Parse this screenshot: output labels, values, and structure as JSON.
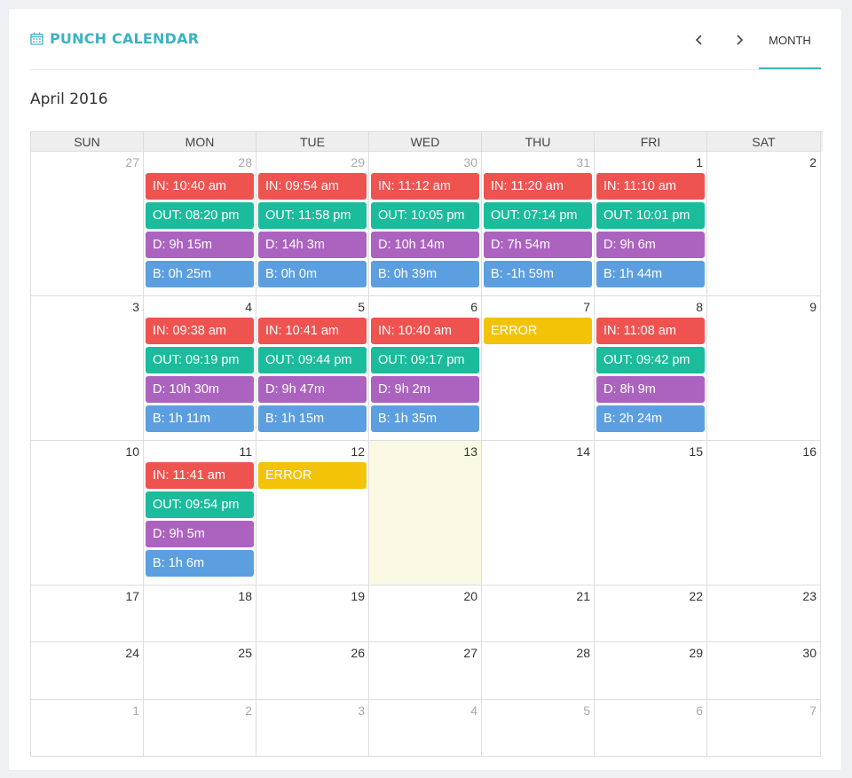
{
  "header": {
    "title": "PUNCH CALENDAR",
    "prev_label": "‹",
    "next_label": "›",
    "view_label": "MONTH"
  },
  "calendar": {
    "month_label": "April 2016",
    "weekdays": [
      "SUN",
      "MON",
      "TUE",
      "WED",
      "THU",
      "FRI",
      "SAT"
    ],
    "weeks": [
      [
        {
          "day": "27",
          "other": true,
          "events": []
        },
        {
          "day": "28",
          "other": true,
          "events": [
            {
              "type": "in",
              "text": "IN: 10:40 am"
            },
            {
              "type": "out",
              "text": "OUT: 08:20 pm"
            },
            {
              "type": "d",
              "text": "D: 9h 15m"
            },
            {
              "type": "b",
              "text": "B: 0h 25m"
            }
          ]
        },
        {
          "day": "29",
          "other": true,
          "events": [
            {
              "type": "in",
              "text": "IN: 09:54 am"
            },
            {
              "type": "out",
              "text": "OUT: 11:58 pm"
            },
            {
              "type": "d",
              "text": "D: 14h 3m"
            },
            {
              "type": "b",
              "text": "B: 0h 0m"
            }
          ]
        },
        {
          "day": "30",
          "other": true,
          "events": [
            {
              "type": "in",
              "text": "IN: 11:12 am"
            },
            {
              "type": "out",
              "text": "OUT: 10:05 pm"
            },
            {
              "type": "d",
              "text": "D: 10h 14m"
            },
            {
              "type": "b",
              "text": "B: 0h 39m"
            }
          ]
        },
        {
          "day": "31",
          "other": true,
          "events": [
            {
              "type": "in",
              "text": "IN: 11:20 am"
            },
            {
              "type": "out",
              "text": "OUT: 07:14 pm"
            },
            {
              "type": "d",
              "text": "D: 7h 54m"
            },
            {
              "type": "b",
              "text": "B: -1h 59m"
            }
          ]
        },
        {
          "day": "1",
          "other": false,
          "events": [
            {
              "type": "in",
              "text": "IN: 11:10 am"
            },
            {
              "type": "out",
              "text": "OUT: 10:01 pm"
            },
            {
              "type": "d",
              "text": "D: 9h 6m"
            },
            {
              "type": "b",
              "text": "B: 1h 44m"
            }
          ]
        },
        {
          "day": "2",
          "other": false,
          "events": []
        }
      ],
      [
        {
          "day": "3",
          "other": false,
          "events": []
        },
        {
          "day": "4",
          "other": false,
          "events": [
            {
              "type": "in",
              "text": "IN: 09:38 am"
            },
            {
              "type": "out",
              "text": "OUT: 09:19 pm"
            },
            {
              "type": "d",
              "text": "D: 10h 30m"
            },
            {
              "type": "b",
              "text": "B: 1h 11m"
            }
          ]
        },
        {
          "day": "5",
          "other": false,
          "events": [
            {
              "type": "in",
              "text": "IN: 10:41 am"
            },
            {
              "type": "out",
              "text": "OUT: 09:44 pm"
            },
            {
              "type": "d",
              "text": "D: 9h 47m"
            },
            {
              "type": "b",
              "text": "B: 1h 15m"
            }
          ]
        },
        {
          "day": "6",
          "other": false,
          "events": [
            {
              "type": "in",
              "text": "IN: 10:40 am"
            },
            {
              "type": "out",
              "text": "OUT: 09:17 pm"
            },
            {
              "type": "d",
              "text": "D: 9h 2m"
            },
            {
              "type": "b",
              "text": "B: 1h 35m"
            }
          ]
        },
        {
          "day": "7",
          "other": false,
          "events": [
            {
              "type": "err",
              "text": "ERROR"
            }
          ]
        },
        {
          "day": "8",
          "other": false,
          "events": [
            {
              "type": "in",
              "text": "IN: 11:08 am"
            },
            {
              "type": "out",
              "text": "OUT: 09:42 pm"
            },
            {
              "type": "d",
              "text": "D: 8h 9m"
            },
            {
              "type": "b",
              "text": "B: 2h 24m"
            }
          ]
        },
        {
          "day": "9",
          "other": false,
          "events": []
        }
      ],
      [
        {
          "day": "10",
          "other": false,
          "events": []
        },
        {
          "day": "11",
          "other": false,
          "events": [
            {
              "type": "in",
              "text": "IN: 11:41 am"
            },
            {
              "type": "out",
              "text": "OUT: 09:54 pm"
            },
            {
              "type": "d",
              "text": "D: 9h 5m"
            },
            {
              "type": "b",
              "text": "B: 1h 6m"
            }
          ]
        },
        {
          "day": "12",
          "other": false,
          "events": [
            {
              "type": "err",
              "text": "ERROR"
            }
          ]
        },
        {
          "day": "13",
          "other": false,
          "today": true,
          "events": []
        },
        {
          "day": "14",
          "other": false,
          "events": []
        },
        {
          "day": "15",
          "other": false,
          "events": []
        },
        {
          "day": "16",
          "other": false,
          "events": []
        }
      ],
      [
        {
          "day": "17",
          "other": false,
          "events": []
        },
        {
          "day": "18",
          "other": false,
          "events": []
        },
        {
          "day": "19",
          "other": false,
          "events": []
        },
        {
          "day": "20",
          "other": false,
          "events": []
        },
        {
          "day": "21",
          "other": false,
          "events": []
        },
        {
          "day": "22",
          "other": false,
          "events": []
        },
        {
          "day": "23",
          "other": false,
          "events": []
        }
      ],
      [
        {
          "day": "24",
          "other": false,
          "events": []
        },
        {
          "day": "25",
          "other": false,
          "events": []
        },
        {
          "day": "26",
          "other": false,
          "events": []
        },
        {
          "day": "27",
          "other": false,
          "events": []
        },
        {
          "day": "28",
          "other": false,
          "events": []
        },
        {
          "day": "29",
          "other": false,
          "events": []
        },
        {
          "day": "30",
          "other": false,
          "events": []
        }
      ],
      [
        {
          "day": "1",
          "other": true,
          "events": []
        },
        {
          "day": "2",
          "other": true,
          "events": []
        },
        {
          "day": "3",
          "other": true,
          "events": []
        },
        {
          "day": "4",
          "other": true,
          "events": []
        },
        {
          "day": "5",
          "other": true,
          "events": []
        },
        {
          "day": "6",
          "other": true,
          "events": []
        },
        {
          "day": "7",
          "other": true,
          "events": []
        }
      ]
    ]
  },
  "colors": {
    "accent": "#3bb3c3",
    "in": "#ef5350",
    "out": "#1abc9c",
    "duration": "#ab63bf",
    "break": "#5c9fe0",
    "error": "#f2c307",
    "today": "#fbf8e3"
  },
  "icons": {
    "title_icon": "calendar-icon"
  }
}
